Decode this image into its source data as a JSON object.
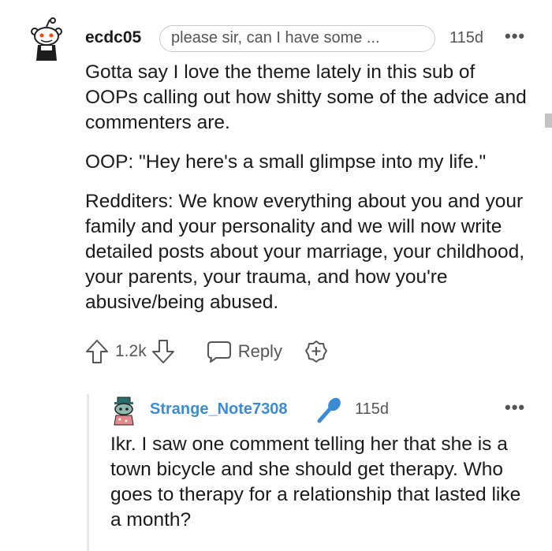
{
  "comment": {
    "username": "ecdc05",
    "flair": "please sir, can I have some ...",
    "time": "115d",
    "more": "•••",
    "paragraphs": [
      "Gotta say I love the theme lately in this sub of OOPs calling out how shitty some of the advice and commenters are.",
      "OOP: \"Hey here's a small glimpse into my life.\"",
      "Redditers: We know everything about you and your family and your personality and we will now write detailed posts about your marriage, your childhood, your parents, your trauma, and how you're abusive/being abused."
    ],
    "votes": "1.2k",
    "reply_label": "Reply"
  },
  "reply": {
    "username": "Strange_Note7308",
    "time": "115d",
    "more": "•••",
    "text": "Ikr. I saw one comment telling her that she is a town bicycle and she should get therapy. Who goes to therapy for a relationship that lasted like a month?"
  },
  "colors": {
    "username_link": "#3a8cd6",
    "text": "#1a1a1b",
    "meta": "#555555",
    "thread_line": "#e8e8e8"
  },
  "icons": [
    "snoo-avatar-icon",
    "upvote-icon",
    "downvote-icon",
    "reply-bubble-icon",
    "award-plus-icon",
    "snoo-avatar-small-icon",
    "microphone-icon"
  ]
}
